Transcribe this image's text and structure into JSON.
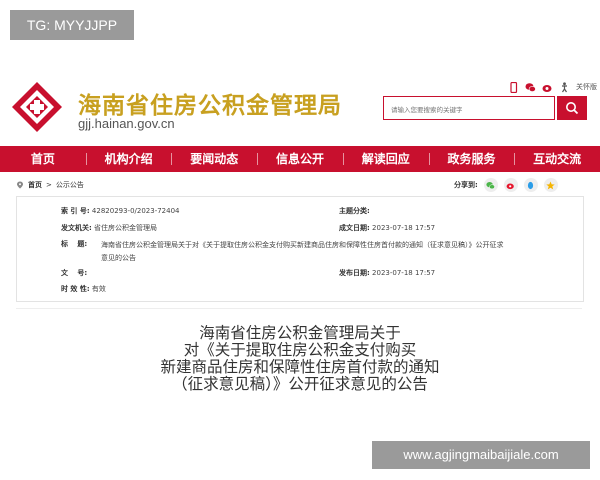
{
  "watermark_top": "TG: MYYJJPP",
  "header": {
    "title": "海南省住房公积金管理局",
    "url": "gjj.hainan.gov.cn",
    "accessibility_label": "关怀版",
    "search_placeholder": "请输入您要搜索的关键字"
  },
  "nav": {
    "items": [
      "首页",
      "机构介绍",
      "要闻动态",
      "信息公开",
      "解读回应",
      "政务服务",
      "互动交流"
    ]
  },
  "breadcrumb": {
    "home": "首页",
    "sep": ">",
    "current": "公示公告"
  },
  "share": {
    "label": "分享到:"
  },
  "info": {
    "index_label": "索 引 号:",
    "index_value": "42820293-0/2023-72404",
    "subject_label": "主题分类:",
    "subject_value": "",
    "issuer_label": "发文机关:",
    "issuer_value": "省住房公积金管理局",
    "created_label": "成文日期:",
    "created_value": "2023-07-18 17:57",
    "title_label": "标　 题:",
    "title_value_1": "海南省住房公积金管理局关于对《关于提取住房公积金支付购买新建商品住房和保障性住房首付款的通知（征求意见稿）》公开征求",
    "title_value_2": "意见的公告",
    "docno_label": "文　 号:",
    "docno_value": "",
    "published_label": "发布日期:",
    "published_value": "2023-07-18 17:57",
    "validity_label": "时 效 性:",
    "validity_value": "有效"
  },
  "doc_title": {
    "line1": "海南省住房公积金管理局关于",
    "line2": "对《关于提取住房公积金支付购买",
    "line3": "新建商品住房和保障性住房首付款的通知",
    "line4": "（征求意见稿）》公开征求意见的公告"
  },
  "watermark_bottom": "www.agjingmaibaijiale.com",
  "colors": {
    "brand_red": "#c8102e",
    "title_gold": "#c8a020"
  }
}
